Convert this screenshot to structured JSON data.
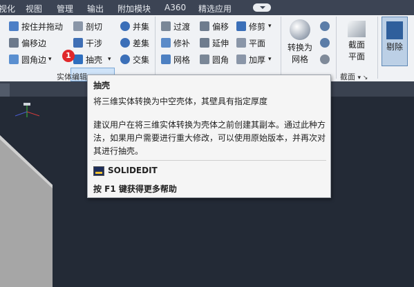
{
  "menu": {
    "items": [
      "视化",
      "视图",
      "管理",
      "输出",
      "附加模块",
      "A360",
      "精选应用"
    ]
  },
  "ribbon": {
    "solid_editing": {
      "col1": [
        "按住并拖动",
        "偏移边",
        "圆角边"
      ],
      "col2": [
        "剖切",
        "干涉",
        "抽壳"
      ],
      "col3": [
        "并集",
        "差集",
        "交集"
      ],
      "panel_label": "实体编辑"
    },
    "mesh": {
      "col1": [
        "过渡",
        "修补",
        "网格"
      ],
      "col2": [
        "偏移",
        "延伸",
        "圆角"
      ],
      "col3": [
        "修剪",
        "平面",
        "加厚"
      ]
    },
    "convert": {
      "label_line1": "转换为",
      "label_line2": "网格"
    },
    "section": {
      "label_line1": "截面",
      "label_line2": "平面",
      "panel_label": "截面"
    },
    "cull": {
      "label": "剔除"
    }
  },
  "step_badge": "1",
  "tooltip": {
    "title": "抽壳",
    "description": "将三维实体转换为中空壳体，其壁具有指定厚度",
    "body": "建议用户在将三维实体转换为壳体之前创建其副本。通过此种方法，如果用户需要进行重大修改，可以使用原始版本，并再次对其进行抽壳。",
    "command": "SOLIDEDIT",
    "help": "按 F1 键获得更多帮助"
  },
  "colors": {
    "accent": "#2f6fbf",
    "badge": "#e0282b",
    "canvas": "#232a36"
  }
}
